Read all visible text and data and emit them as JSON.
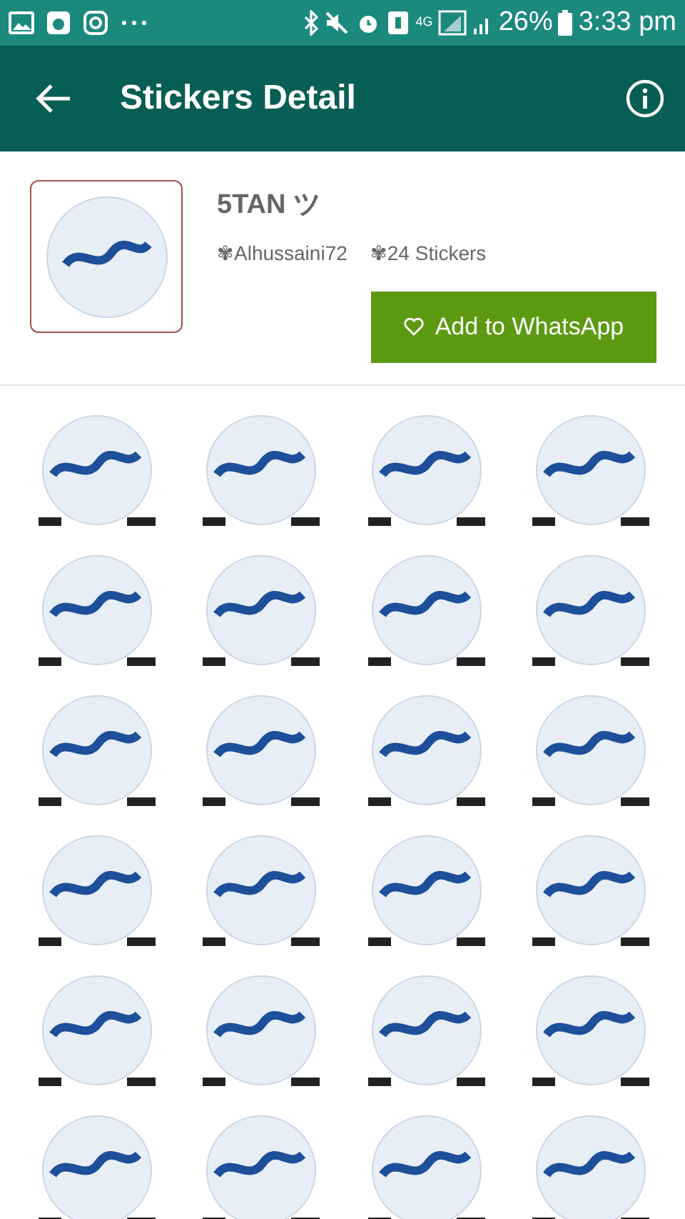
{
  "status_bar": {
    "battery": "26%",
    "time": "3:33 pm",
    "network": "4G"
  },
  "app_bar": {
    "title": "Stickers Detail"
  },
  "pack": {
    "name": "5TAN ツ",
    "author": "✾Alhussaini72",
    "count": "✾24 Stickers",
    "button": "Add to WhatsApp"
  },
  "stickers": [
    {
      "kind": "image"
    },
    {
      "kind": "image"
    },
    {
      "kind": "image"
    },
    {
      "kind": "image"
    },
    {
      "kind": "image"
    },
    {
      "kind": "image"
    },
    {
      "kind": "image"
    },
    {
      "kind": "image"
    },
    {
      "kind": "image"
    },
    {
      "kind": "image"
    },
    {
      "kind": "image"
    },
    {
      "kind": "image"
    },
    {
      "kind": "image"
    },
    {
      "kind": "image"
    },
    {
      "kind": "image"
    },
    {
      "kind": "image"
    },
    {
      "kind": "image"
    },
    {
      "kind": "image"
    },
    {
      "kind": "image"
    },
    {
      "kind": "image"
    },
    {
      "kind": "image"
    },
    {
      "kind": "image"
    },
    {
      "kind": "image"
    },
    {
      "kind": "image"
    }
  ]
}
